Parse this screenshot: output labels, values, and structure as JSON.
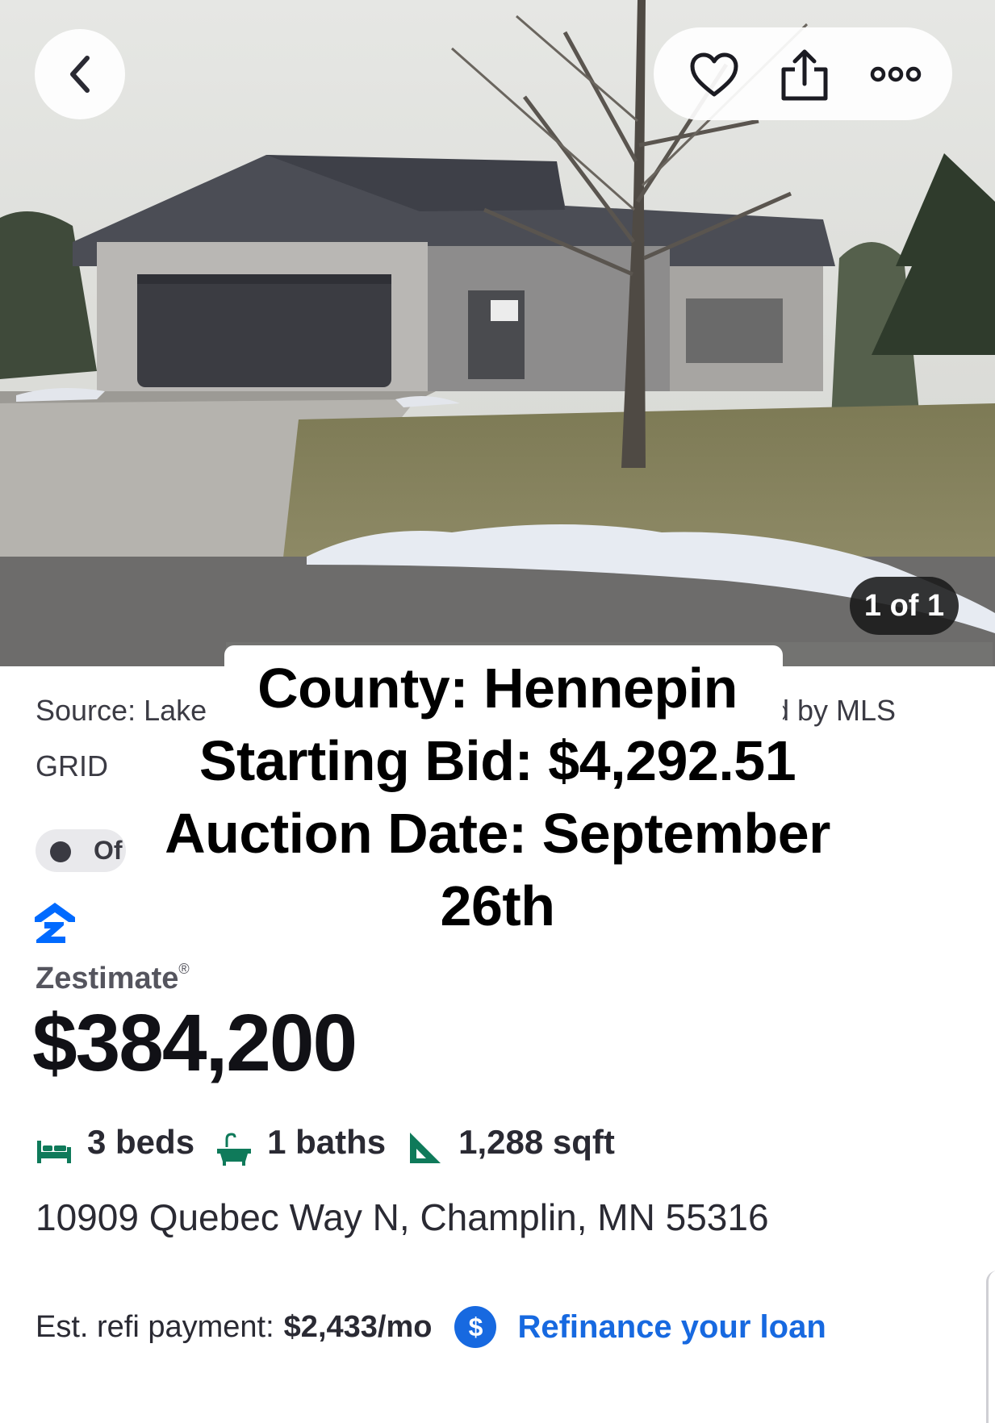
{
  "photo": {
    "counter": "1 of 1",
    "alt": "House exterior"
  },
  "toolbar": {
    "back_icon": "chevron-left-icon",
    "save_icon": "heart-icon",
    "share_icon": "share-icon",
    "more_icon": "more-icon"
  },
  "listing": {
    "source_left": "Source: Lake",
    "source_right": "d by MLS",
    "source_line2": "GRID",
    "status": "Of",
    "zestimate_label": "Zestimate",
    "zestimate_mark": "®",
    "zestimate_value": "$384,200",
    "beds": "3 beds",
    "baths": "1 baths",
    "sqft": "1,288 sqft",
    "address": "10909 Quebec Way N, Champlin, MN 55316",
    "refi_label": "Est. refi payment:",
    "refi_value": "$2,433/mo",
    "refi_icon": "$",
    "refi_link": "Refinance your loan"
  },
  "overlay": {
    "line1": "County: Hennepin",
    "line2": "Starting Bid: $4,292.51",
    "line3": "Auction Date: September",
    "line4": "26th"
  },
  "colors": {
    "accent_blue": "#1769e0",
    "zillow_blue": "#006aff",
    "fact_icon_green": "#0f7a5a"
  }
}
